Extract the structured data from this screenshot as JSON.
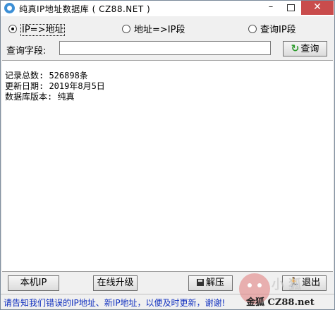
{
  "window": {
    "title": "纯真IP地址数据库 ( CZ88.NET )",
    "controls": {
      "minimize": "–",
      "maximize": "",
      "close": "✕"
    }
  },
  "search_mode": {
    "options": [
      {
        "label": "IP=>地址",
        "selected": true
      },
      {
        "label": "地址=>IP段",
        "selected": false
      },
      {
        "label": "查询IP段",
        "selected": false
      }
    ]
  },
  "query": {
    "label": "查询字段:",
    "value": "",
    "button_label": "查询",
    "button_icon": "refresh-icon"
  },
  "output": {
    "lines": [
      "记录总数: 526898条",
      "更新日期: 2019年8月5日",
      "数据库版本: 纯真"
    ]
  },
  "buttons": {
    "local_ip": "本机IP",
    "online_upgrade": "在线升级",
    "unpack": "解压",
    "exit": "退出"
  },
  "status": {
    "text": "请告知我们错误的IP地址、新IP地址，以便及时更新，谢谢!"
  },
  "watermark": {
    "big_text": "小狐",
    "brand": "金狐 CZ88.net"
  }
}
